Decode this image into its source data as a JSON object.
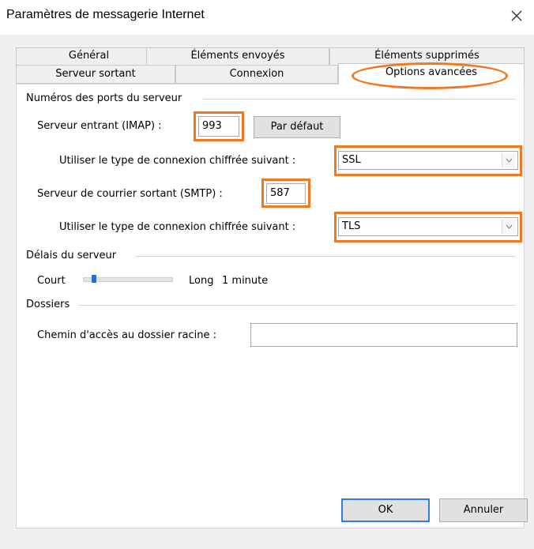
{
  "window": {
    "title": "Paramètres de messagerie Internet"
  },
  "tabs": {
    "row1": [
      "Général",
      "Éléments envoyés",
      "Éléments supprimés"
    ],
    "row2": [
      "Serveur sortant",
      "Connexion",
      "Options avancées"
    ],
    "active": "Options avancées"
  },
  "ports": {
    "section_label": "Numéros des ports du serveur",
    "incoming_label": "Serveur entrant (IMAP) :",
    "incoming_value": "993",
    "default_button": "Par défaut",
    "incoming_encryption_label": "Utiliser le type de connexion chiffrée suivant :",
    "incoming_encryption_value": "SSL",
    "outgoing_label": "Serveur de courrier sortant (SMTP) :",
    "outgoing_value": "587",
    "outgoing_encryption_label": "Utiliser le type de connexion chiffrée suivant :",
    "outgoing_encryption_value": "TLS"
  },
  "timeouts": {
    "section_label": "Délais du serveur",
    "short_label": "Court",
    "long_label": "Long",
    "value_label": "1 minute",
    "slider_level": 0.1
  },
  "folders": {
    "section_label": "Dossiers",
    "root_path_label": "Chemin d'accès au dossier racine :",
    "root_path_value": ""
  },
  "footer": {
    "ok_label": "OK",
    "cancel_label": "Annuler"
  },
  "colors": {
    "highlight": "#f07820",
    "accent": "#2f7fd9"
  }
}
